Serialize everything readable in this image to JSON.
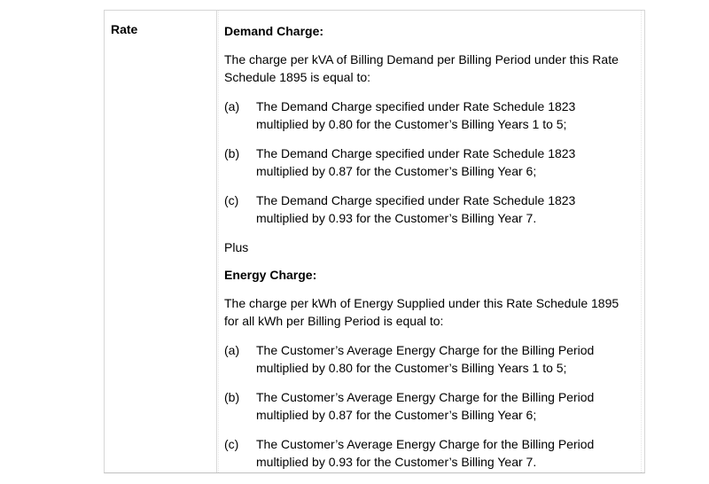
{
  "row": {
    "label": "Rate"
  },
  "demand": {
    "heading": "Demand Charge:",
    "intro_line1": "The charge per kVA of Billing Demand per Billing Period under this Rate",
    "intro_line2": "Schedule 1895 is equal to:",
    "items": [
      {
        "mark": "(a)",
        "line1": "The Demand Charge specified under Rate Schedule 1823",
        "line2": "multiplied by 0.80 for the Customer’s Billing Years 1 to 5;"
      },
      {
        "mark": "(b)",
        "line1": "The Demand Charge specified under Rate Schedule 1823",
        "line2": "multiplied by 0.87 for the Customer’s Billing Year 6;"
      },
      {
        "mark": "(c)",
        "line1": "The Demand Charge specified under Rate Schedule 1823",
        "line2": "multiplied by 0.93 for the Customer’s Billing Year 7."
      }
    ]
  },
  "plus": "Plus",
  "energy": {
    "heading": "Energy Charge:",
    "intro_line1": "The charge per kWh of Energy Supplied under this Rate Schedule 1895",
    "intro_line2": "for all kWh per Billing Period is equal to:",
    "items": [
      {
        "mark": "(a)",
        "line1": "The Customer’s Average Energy Charge for the Billing Period",
        "line2": "multiplied by 0.80 for the Customer’s Billing Years 1 to 5;"
      },
      {
        "mark": "(b)",
        "line1": "The Customer’s Average Energy Charge for the Billing Period",
        "line2": "multiplied by 0.87 for the Customer’s Billing Year 6;"
      },
      {
        "mark": "(c)",
        "line1": "The Customer’s Average Energy Charge for the Billing Period",
        "line2": "multiplied by 0.93 for the Customer’s Billing Year 7."
      }
    ]
  }
}
